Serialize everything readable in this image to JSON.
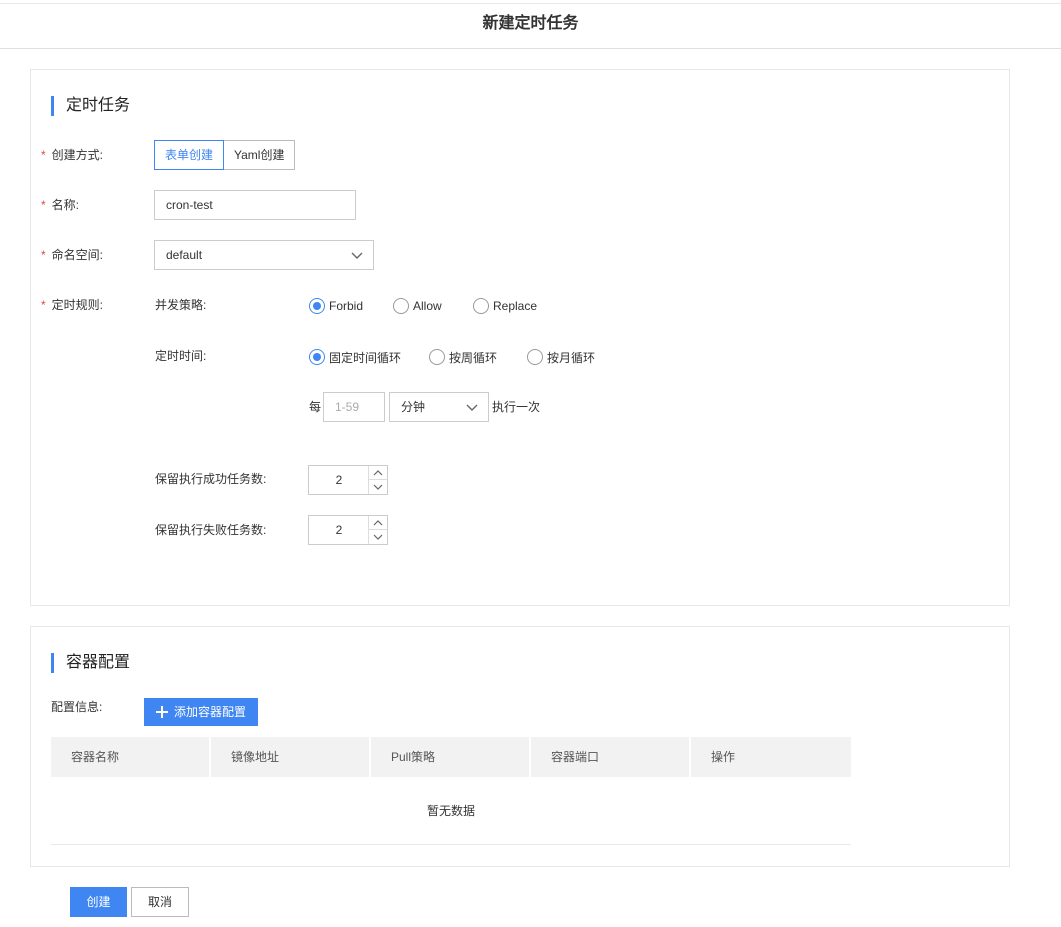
{
  "page": {
    "title": "新建定时任务"
  },
  "section1": {
    "title": "定时任务",
    "create_mode": {
      "label": "创建方式:",
      "options": [
        "表单创建",
        "Yaml创建"
      ],
      "selected": "表单创建"
    },
    "name": {
      "label": "名称:",
      "value": "cron-test"
    },
    "namespace": {
      "label": "命名空间:",
      "value": "default"
    },
    "schedule_rule": {
      "label": "定时规则:",
      "concurrency": {
        "label": "并发策略:",
        "options": [
          "Forbid",
          "Allow",
          "Replace"
        ],
        "selected": "Forbid"
      },
      "timing": {
        "label": "定时时间:",
        "options": [
          "固定时间循环",
          "按周循环",
          "按月循环"
        ],
        "selected": "固定时间循环"
      },
      "every": {
        "prefix": "每",
        "placeholder": "1-59",
        "unit": "分钟",
        "suffix": "执行一次"
      }
    },
    "success_history": {
      "label": "保留执行成功任务数:",
      "value": "2"
    },
    "failed_history": {
      "label": "保留执行失败任务数:",
      "value": "2"
    }
  },
  "section2": {
    "title": "容器配置",
    "config_label": "配置信息:",
    "add_button": "添加容器配置",
    "table": {
      "columns": [
        "容器名称",
        "镜像地址",
        "Pull策略",
        "容器端口",
        "操作"
      ],
      "empty_text": "暂无数据"
    }
  },
  "footer": {
    "create": "创建",
    "cancel": "取消"
  },
  "colors": {
    "accent": "#3f86f3",
    "required": "#e5463d"
  }
}
